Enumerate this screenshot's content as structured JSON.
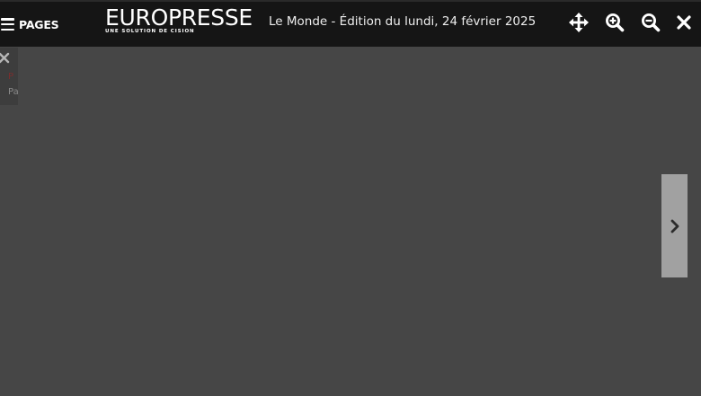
{
  "header": {
    "pages_label": "PAGES",
    "logo_text": "EUROPRESSE",
    "logo_tagline": "UNE SOLUTION DE CISION",
    "edition_title": "Le Monde - Édition du lundi, 24 février 2025"
  },
  "toolbar": {
    "icons": [
      "move-icon",
      "zoom-in-icon",
      "zoom-out-icon",
      "close-icon"
    ]
  },
  "side_panel": {
    "line1": "P",
    "line2": "Pa"
  },
  "navigation": {
    "next_icon": "chevron-right-icon"
  },
  "colors": {
    "header_bg": "#151515",
    "viewer_bg": "#464646",
    "next_button_bg": "#a1a1a1"
  }
}
